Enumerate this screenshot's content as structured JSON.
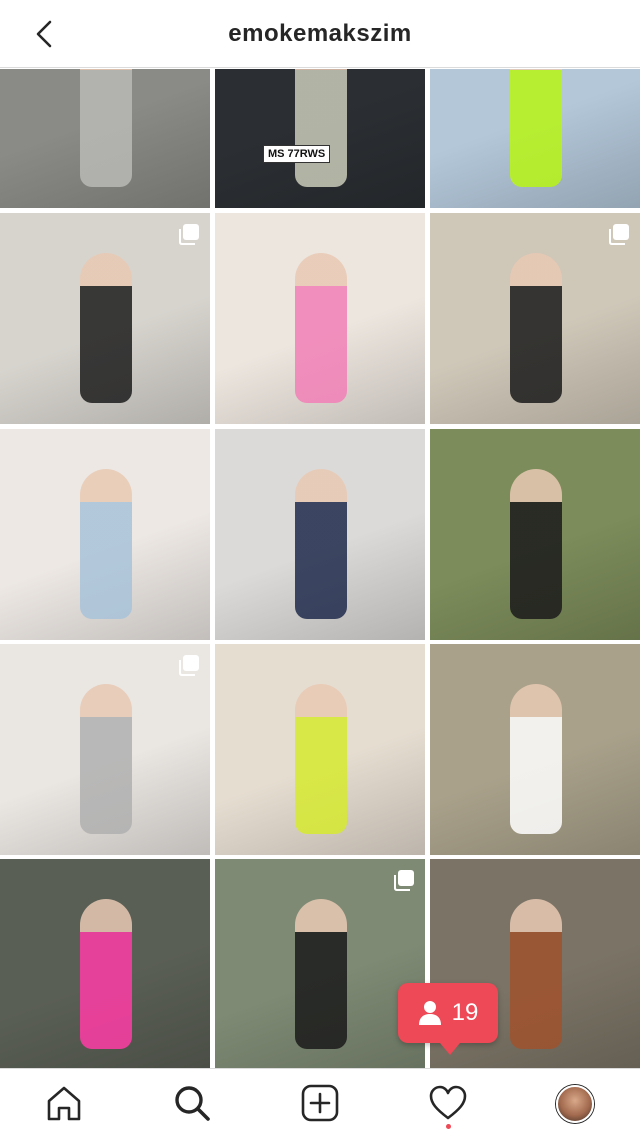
{
  "header": {
    "username": "emokemakszim",
    "back_icon": "chevron-left-icon"
  },
  "posts": [
    {
      "label": "post-1",
      "multi": false,
      "bg": "#8a8a86",
      "accent": "#b9b9b5"
    },
    {
      "label": "post-2",
      "multi": false,
      "bg": "#2b2f33",
      "accent": "#c9cbb8",
      "plate": "MS 77RWS"
    },
    {
      "label": "post-3",
      "multi": false,
      "bg": "#b3c7d9",
      "accent": "#b8f515"
    },
    {
      "label": "post-4",
      "multi": true,
      "bg": "#d7d4ce",
      "accent": "#1c1c1c"
    },
    {
      "label": "post-5",
      "multi": false,
      "bg": "#ede6df",
      "accent": "#f27fb7"
    },
    {
      "label": "post-6",
      "multi": true,
      "bg": "#cfc7b8",
      "accent": "#1a1a1a"
    },
    {
      "label": "post-7",
      "multi": false,
      "bg": "#ede8e4",
      "accent": "#a8c3d9"
    },
    {
      "label": "post-8",
      "multi": false,
      "bg": "#dcdad8",
      "accent": "#1f2b4c"
    },
    {
      "label": "post-9",
      "multi": false,
      "bg": "#7c8c5a",
      "accent": "#1a1a1a"
    },
    {
      "label": "post-10",
      "multi": true,
      "bg": "#eae6e2",
      "accent": "#b0b0b0"
    },
    {
      "label": "post-11",
      "multi": false,
      "bg": "#e6ddd1",
      "accent": "#d6ea2f"
    },
    {
      "label": "post-12",
      "multi": false,
      "bg": "#a9a18a",
      "accent": "#ffffff"
    },
    {
      "label": "post-13",
      "multi": false,
      "bg": "#5a5f55",
      "accent": "#ff3ca6"
    },
    {
      "label": "post-14",
      "multi": true,
      "bg": "#7e8a74",
      "accent": "#1a1a1a"
    },
    {
      "label": "post-15",
      "multi": false,
      "bg": "#7b7466",
      "accent": "#a0522d"
    }
  ],
  "followers_notification": {
    "icon": "person-icon",
    "count": "19",
    "color": "#ed4956"
  },
  "tabbar": {
    "items": [
      "home-icon",
      "search-icon",
      "add-post-icon",
      "activity-heart-icon",
      "profile-avatar"
    ],
    "active": "search-icon"
  },
  "colors": {
    "text": "#262626",
    "border": "#dbdbdb",
    "notification": "#ed4956"
  }
}
